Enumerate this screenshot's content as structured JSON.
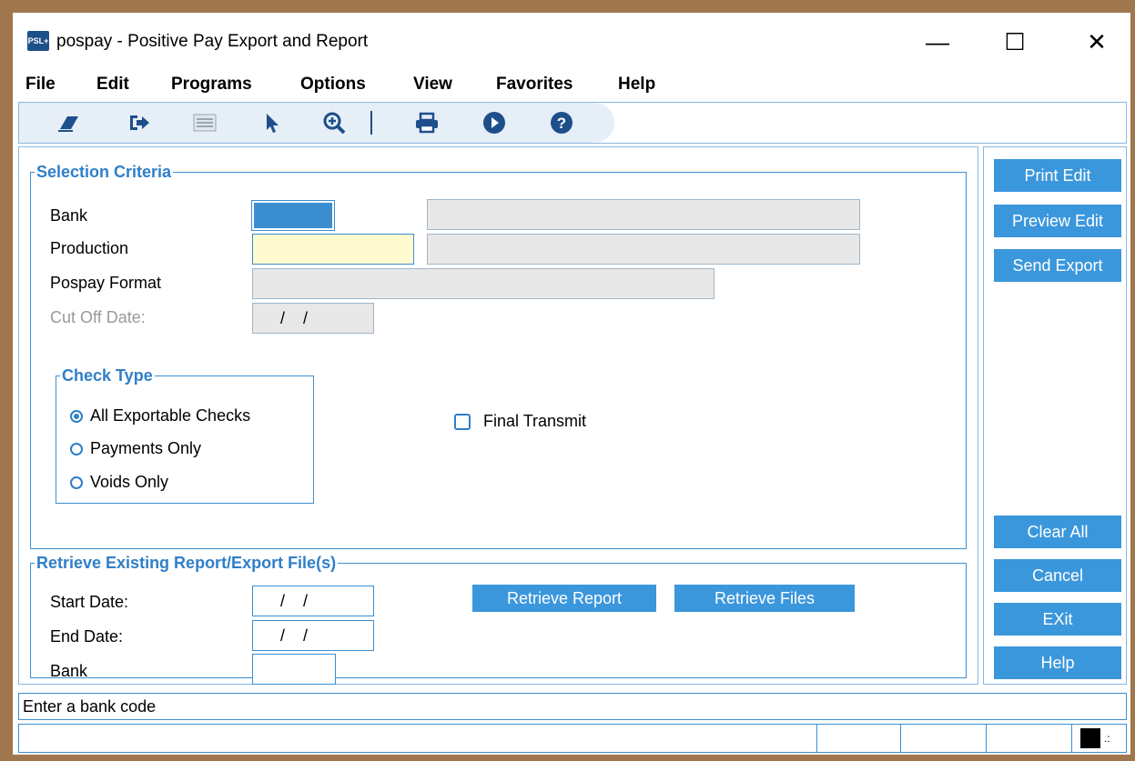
{
  "window": {
    "app_icon_text": "PSL+",
    "title": "pospay - Positive Pay Export and Report",
    "minimize": "—",
    "maximize": "☐",
    "close": "✕"
  },
  "menu": [
    "File",
    "Edit",
    "Programs",
    "Options",
    "View",
    "Favorites",
    "Help"
  ],
  "toolbar": {
    "icons": [
      "eraser-icon",
      "exit-icon",
      "list-icon",
      "pointer-icon",
      "zoom-in-icon",
      "print-icon",
      "run-icon",
      "help-icon"
    ],
    "accent": "#1d4f8a"
  },
  "selection": {
    "legend": "Selection Criteria",
    "bank_label": "Bank",
    "production_label": "Production",
    "format_label": "Pospay Format",
    "cutoff_label": "Cut Off Date:",
    "cutoff_value": "/    /"
  },
  "check_type": {
    "legend": "Check Type",
    "options": [
      "All Exportable Checks",
      "Payments Only",
      "Voids Only"
    ],
    "selected": "All Exportable Checks"
  },
  "final_transmit": {
    "label": "Final Transmit",
    "checked": false
  },
  "retrieve": {
    "legend": "Retrieve Existing Report/Export File(s)",
    "start_label": "Start Date:",
    "start_value": "/    /",
    "end_label": "End Date:",
    "end_value": "/    /",
    "bank_label": "Bank",
    "report_button": "Retrieve Report",
    "files_button": "Retrieve Files"
  },
  "side_buttons": {
    "print_edit": "Print Edit",
    "preview_edit": "Preview Edit",
    "send_export": "Send Export",
    "clear_all": "Clear All",
    "cancel": "Cancel",
    "exit": "EXit",
    "help": "Help"
  },
  "status": {
    "message": "Enter a bank code"
  },
  "colors": {
    "accent": "#3b97dc",
    "legend": "#2f7fc8",
    "frame": "#a0764c"
  }
}
